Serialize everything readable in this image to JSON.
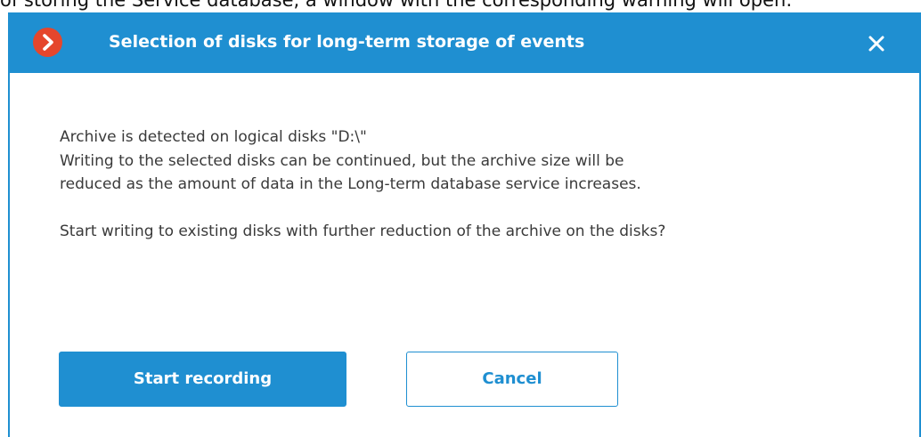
{
  "document_caption": "of storing the Service database, a window with the corresponding warning will open:",
  "dialog": {
    "title": "Selection of disks for long-term storage of events",
    "logo_icon": "app-logo-icon",
    "close_icon": "close-icon",
    "message": {
      "line1": "Archive is detected on logical disks \"D:\\\"",
      "line2": " Writing to the selected disks can be continued, but the archive size will be",
      "line3": "reduced as the amount of data in the Long-term database service increases.",
      "question": "Start writing to existing disks with further reduction of the archive on the disks?"
    },
    "buttons": {
      "primary_label": "Start recording",
      "secondary_label": "Cancel"
    }
  },
  "colors": {
    "accent": "#1f8fd1",
    "logo": "#e5462c",
    "text": "#3a3a3a"
  }
}
